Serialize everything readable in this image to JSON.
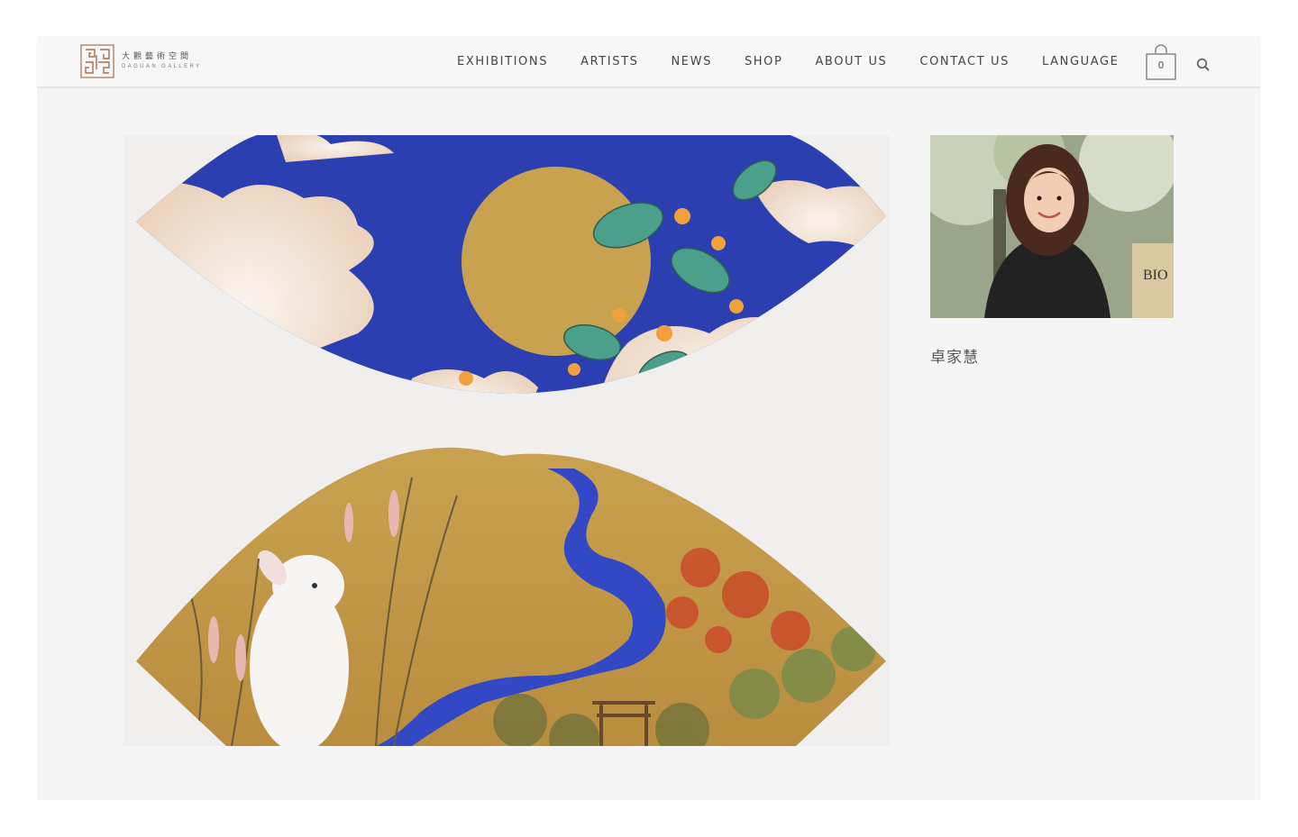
{
  "brand": {
    "name_cn": "大觀藝術空間",
    "name_en": "DAGUAN GALLERY",
    "accent_color": "#a5704f"
  },
  "nav": {
    "items": [
      {
        "label": "EXHIBITIONS"
      },
      {
        "label": "ARTISTS"
      },
      {
        "label": "NEWS"
      },
      {
        "label": "SHOP"
      },
      {
        "label": "ABOUT US"
      },
      {
        "label": "CONTACT US"
      },
      {
        "label": "LANGUAGE"
      }
    ]
  },
  "cart": {
    "count": "0",
    "icon": "shopping-bag-icon"
  },
  "search": {
    "icon": "search-icon"
  },
  "artwork": {
    "description_icon": "fan-painting-image",
    "colors": {
      "sky": "#2b3fb0",
      "gold": "#c9a24f",
      "river": "#3348c4"
    }
  },
  "artist": {
    "name": "卓家慧",
    "photo_icon": "artist-portrait-image"
  }
}
